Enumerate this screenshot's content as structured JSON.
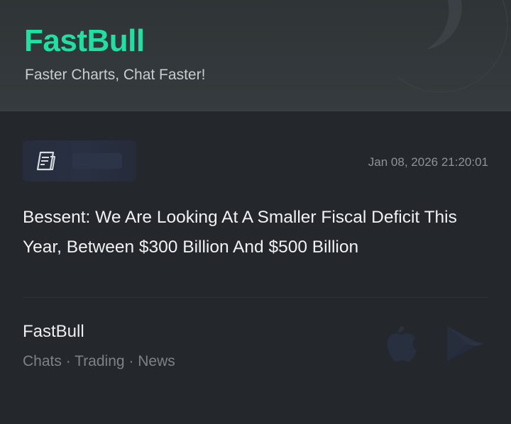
{
  "header": {
    "brand_name": "FastBull",
    "tagline": "Faster Charts, Chat Faster!",
    "accent_color": "#1ee0a1",
    "decoration_icon": "moon-arc-icon"
  },
  "article": {
    "category_icon": "news-document-icon",
    "timestamp": "Jan 08, 2026 21:20:01",
    "headline": "Bessent: We Are Looking At A Smaller Fiscal Deficit This Year, Between $300 Billion And $500 Billion"
  },
  "footer": {
    "title": "FastBull",
    "tags": "Chats · Trading · News",
    "icons": [
      "apple-store-icon",
      "google-play-icon"
    ]
  }
}
